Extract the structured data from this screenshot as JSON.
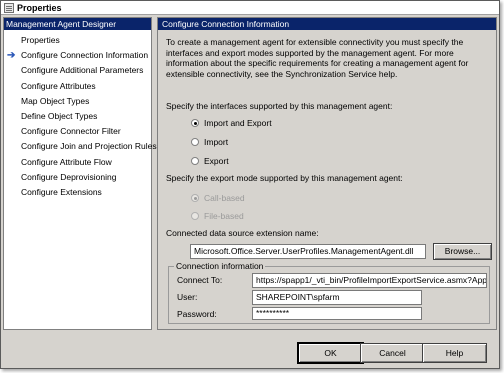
{
  "window": {
    "title": "Properties"
  },
  "left": {
    "header": "Management Agent Designer",
    "items": [
      {
        "label": "Properties"
      },
      {
        "label": "Configure Connection Information",
        "active": true
      },
      {
        "label": "Configure Additional Parameters"
      },
      {
        "label": "Configure Attributes"
      },
      {
        "label": "Map Object Types"
      },
      {
        "label": "Define Object Types"
      },
      {
        "label": "Configure Connector Filter"
      },
      {
        "label": "Configure Join and Projection Rules"
      },
      {
        "label": "Configure Attribute Flow"
      },
      {
        "label": "Configure Deprovisioning"
      },
      {
        "label": "Configure Extensions"
      }
    ]
  },
  "right": {
    "header": "Configure Connection Information",
    "intro": "To create a management agent for extensible connectivity you must specify the interfaces and export modes supported by the management agent. For more information about the specific requirements for creating a management agent for extensible connectivity, see the Synchronization Service help.",
    "interfaces_label": "Specify the interfaces supported by this management agent:",
    "interfaces": [
      {
        "label": "Import and Export",
        "checked": true
      },
      {
        "label": "Import",
        "checked": false
      },
      {
        "label": "Export",
        "checked": false
      }
    ],
    "export_label": "Specify the export mode supported by this management agent:",
    "export_modes": [
      {
        "label": "Call-based",
        "checked": true,
        "disabled": true
      },
      {
        "label": "File-based",
        "checked": false,
        "disabled": true
      }
    ],
    "extension_label": "Connected data source extension name:",
    "extension_value": "Microsoft.Office.Server.UserProfiles.ManagementAgent.dll",
    "browse_label": "Browse...",
    "connection": {
      "title": "Connection information",
      "connect_to_label": "Connect To:",
      "connect_to_value": "https://spapp1/_vti_bin/ProfileImportExportService.asmx?App",
      "user_label": "User:",
      "user_value": "SHAREPOINT\\spfarm",
      "password_label": "Password:",
      "password_value": "**********"
    }
  },
  "buttons": {
    "ok": "OK",
    "cancel": "Cancel",
    "help": "Help"
  }
}
